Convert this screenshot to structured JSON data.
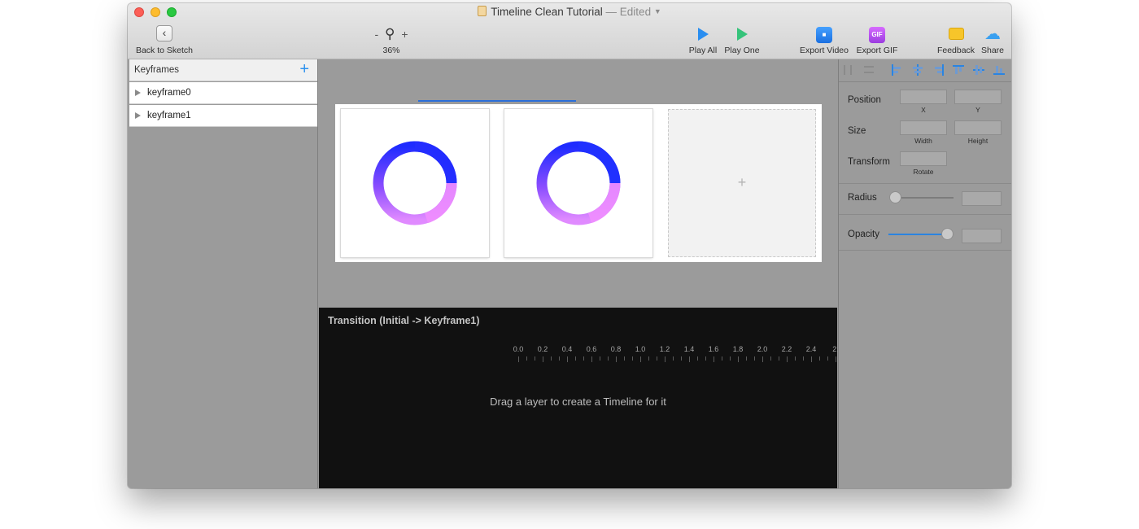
{
  "window": {
    "title": "Timeline Clean Tutorial",
    "edited": "— Edited"
  },
  "toolbar": {
    "back_label": "Back to Sketch",
    "zoom_minus": "-",
    "zoom_plus": "+",
    "zoom_level": "36%",
    "play_all_label": "Play All",
    "play_one_label": "Play One",
    "export_video_label": "Export Video",
    "export_gif_label": "Export GIF",
    "gif_icon_text": "GIF",
    "feedback_label": "Feedback",
    "share_label": "Share"
  },
  "keyframes": {
    "header": "Keyframes",
    "add_symbol": "+",
    "items": [
      {
        "label": "keyframe0"
      },
      {
        "label": "keyframe1"
      }
    ]
  },
  "canvas": {
    "empty_frame_symbol": "+",
    "ring_colors": {
      "top": "#1f2bff",
      "bottom": "#f290ff",
      "mid": "#8a4dff"
    }
  },
  "timeline": {
    "title": "Transition (Initial -> Keyframe1)",
    "ruler_labels": [
      "0.0",
      "0.2",
      "0.4",
      "0.6",
      "0.8",
      "1.0",
      "1.2",
      "1.4",
      "1.6",
      "1.8",
      "2.0",
      "2.2",
      "2.4",
      "2."
    ],
    "empty_message": "Drag a layer to create a Timeline for it"
  },
  "inspector": {
    "position_label": "Position",
    "x_label": "X",
    "y_label": "Y",
    "size_label": "Size",
    "width_label": "Width",
    "height_label": "Height",
    "transform_label": "Transform",
    "rotate_label": "Rotate",
    "radius_label": "Radius",
    "radius_value": 0.0,
    "opacity_label": "Opacity",
    "opacity_value": 0.9
  },
  "colors": {
    "accent": "#2b84e0",
    "play_all": "#2a8ef0",
    "play_one": "#35c37a"
  }
}
